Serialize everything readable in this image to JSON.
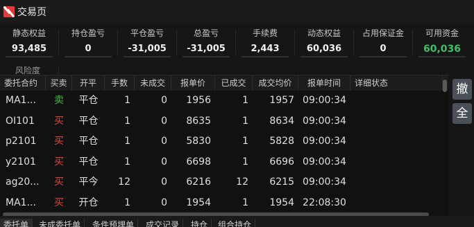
{
  "window": {
    "title": "交易页"
  },
  "stats": [
    {
      "label": "静态权益",
      "value": "93,485",
      "color": "#f0f0f0"
    },
    {
      "label": "持仓盈亏",
      "value": "0",
      "color": "#f0f0f0"
    },
    {
      "label": "平仓盈亏",
      "value": "-31,005",
      "color": "#f0f0f0"
    },
    {
      "label": "总盈亏",
      "value": "-31,005",
      "color": "#f0f0f0"
    },
    {
      "label": "手续费",
      "value": "2,443",
      "color": "#f0f0f0"
    },
    {
      "label": "动态权益",
      "value": "60,036",
      "color": "#f0f0f0"
    },
    {
      "label": "占用保证金",
      "value": "0",
      "color": "#f0f0f0"
    },
    {
      "label": "可用资金",
      "value": "60,036",
      "color": "#3fbf6a"
    }
  ],
  "risk_label": "风险度",
  "table": {
    "headers": [
      "委托合约",
      "买卖",
      "开平",
      "手数",
      "未成交",
      "报单价",
      "已成交",
      "成交均价",
      "报单时间",
      "详细状态"
    ],
    "rows": [
      [
        "MA1...",
        "卖",
        "平仓",
        "1",
        "0",
        "1956",
        "1",
        "1957",
        "09:00:34",
        ""
      ],
      [
        "OI101",
        "买",
        "平仓",
        "1",
        "0",
        "8635",
        "1",
        "8634",
        "09:00:34",
        ""
      ],
      [
        "p2101",
        "买",
        "平仓",
        "1",
        "0",
        "5830",
        "1",
        "5828",
        "09:00:34",
        ""
      ],
      [
        "y2101",
        "买",
        "平仓",
        "1",
        "0",
        "6698",
        "1",
        "6696",
        "09:00:34",
        ""
      ],
      [
        "ag20...",
        "买",
        "平今",
        "12",
        "0",
        "6216",
        "12",
        "6215",
        "09:00:34",
        ""
      ],
      [
        "MA1...",
        "买",
        "开仓",
        "1",
        "0",
        "1954",
        "1",
        "1954",
        "22:08:30",
        ""
      ]
    ]
  },
  "side_buttons": [
    "撤",
    "全"
  ],
  "tabs": [
    "委托单",
    "未成委托单",
    "条件预埋单",
    "成交记录",
    "持仓",
    "组合持仓"
  ],
  "colors": {
    "buy": "#e0443c",
    "sell": "#3fbf3f",
    "accent": "#4a8fd8"
  }
}
